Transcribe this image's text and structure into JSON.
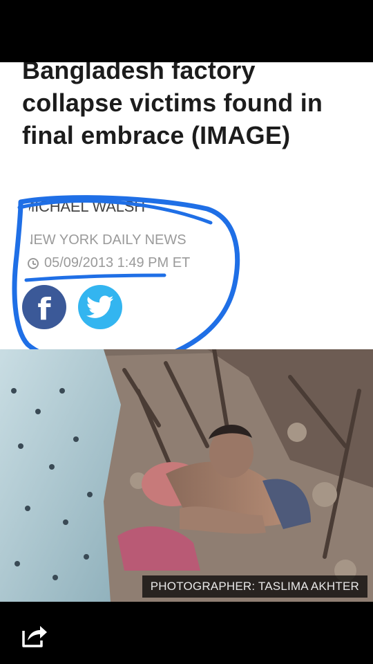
{
  "article": {
    "headline": "Bangladesh factory collapse victims found in final embrace (IMAGE)",
    "author": "MICHAEL WALSH",
    "source": "NEW YORK DAILY NEWS",
    "timestamp": "05/09/2013 1:49 PM ET"
  },
  "social": [
    {
      "name": "facebook",
      "glyph": "f",
      "color": "#3b5998"
    },
    {
      "name": "twitter",
      "color": "#33b5f0"
    }
  ],
  "photo": {
    "credit": "PHOTOGRAPHER: TASLIMA AKHTER"
  },
  "annotation": {
    "color": "#1f6fe6"
  },
  "toolbar": {
    "share_icon": "share-icon"
  }
}
